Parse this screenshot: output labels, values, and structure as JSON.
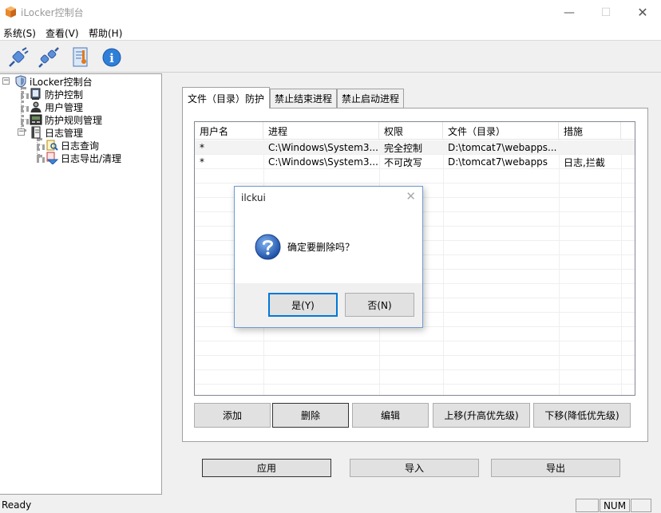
{
  "window": {
    "title": "iLocker控制台"
  },
  "menu": [
    "系统(S)",
    "查看(V)",
    "帮助(H)"
  ],
  "toolbar": [
    {
      "icon": "plug-connect-icon"
    },
    {
      "icon": "plug-disconnect-icon"
    },
    {
      "icon": "settings-document-icon"
    },
    {
      "icon": "info-icon",
      "symbol": "i"
    }
  ],
  "tree": {
    "root": "iLocker控制台",
    "items": [
      "防护控制",
      "用户管理",
      "防护规则管理",
      "日志管理"
    ],
    "log_children": [
      "日志查询",
      "日志导出/清理"
    ],
    "expander_open": "−"
  },
  "tabs": [
    "文件（目录）防护",
    "禁止结束进程",
    "禁止启动进程"
  ],
  "table": {
    "columns": [
      "用户名",
      "进程",
      "权限",
      "文件（目录）",
      "措施"
    ],
    "rows": [
      [
        "*",
        "C:\\Windows\\System3...",
        "完全控制",
        "D:\\tomcat7\\webapps...",
        ""
      ],
      [
        "*",
        "C:\\Windows\\System3...",
        "不可改写",
        "D:\\tomcat7\\webapps",
        "日志,拦截"
      ]
    ]
  },
  "buttons": {
    "add": "添加",
    "delete": "删除",
    "edit": "编辑",
    "move_up": "上移(升高优先级)",
    "move_down": "下移(降低优先级)",
    "apply": "应用",
    "import": "导入",
    "export": "导出"
  },
  "dialog": {
    "title": "ilckui",
    "message": "确定要删除吗？",
    "yes": "是(Y)",
    "no": "否(N)",
    "close_glyph": "✕"
  },
  "window_controls": {
    "minimize": "—",
    "maximize": "☐",
    "close": "✕"
  },
  "statusbar": {
    "text": "Ready",
    "num": "NUM"
  }
}
